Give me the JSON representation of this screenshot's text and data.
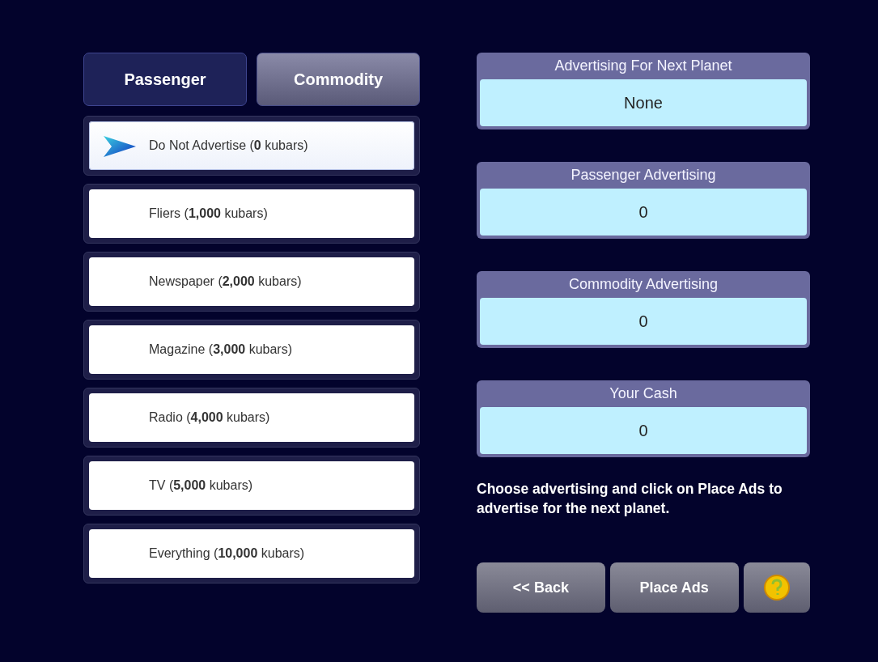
{
  "tabs": [
    {
      "label": "Passenger",
      "selected": true
    },
    {
      "label": "Commodity",
      "selected": false
    }
  ],
  "options": [
    {
      "label": "Do Not Advertise (**0** kubars)",
      "selected": true
    },
    {
      "label": "Fliers (**1,000** kubars)",
      "selected": false
    },
    {
      "label": "Newspaper (**2,000** kubars)",
      "selected": false
    },
    {
      "label": "Magazine (**3,000** kubars)",
      "selected": false
    },
    {
      "label": "Radio (**4,000** kubars)",
      "selected": false
    },
    {
      "label": "TV (**5,000** kubars)",
      "selected": false
    },
    {
      "label": "Everything (**10,000** kubars)",
      "selected": false
    }
  ],
  "panels": [
    {
      "title": "Advertising For Next Planet",
      "value": "None"
    },
    {
      "title": "Passenger Advertising",
      "value": "0"
    },
    {
      "title": "Commodity Advertising",
      "value": "0"
    },
    {
      "title": "Your Cash",
      "value": "0"
    }
  ],
  "instructions": "Choose advertising and click on Place Ads to advertise for the next planet.",
  "buttons": [
    {
      "kind": "text",
      "label": "<< Back"
    },
    {
      "kind": "text",
      "label": "Place Ads"
    },
    {
      "kind": "help"
    }
  ]
}
